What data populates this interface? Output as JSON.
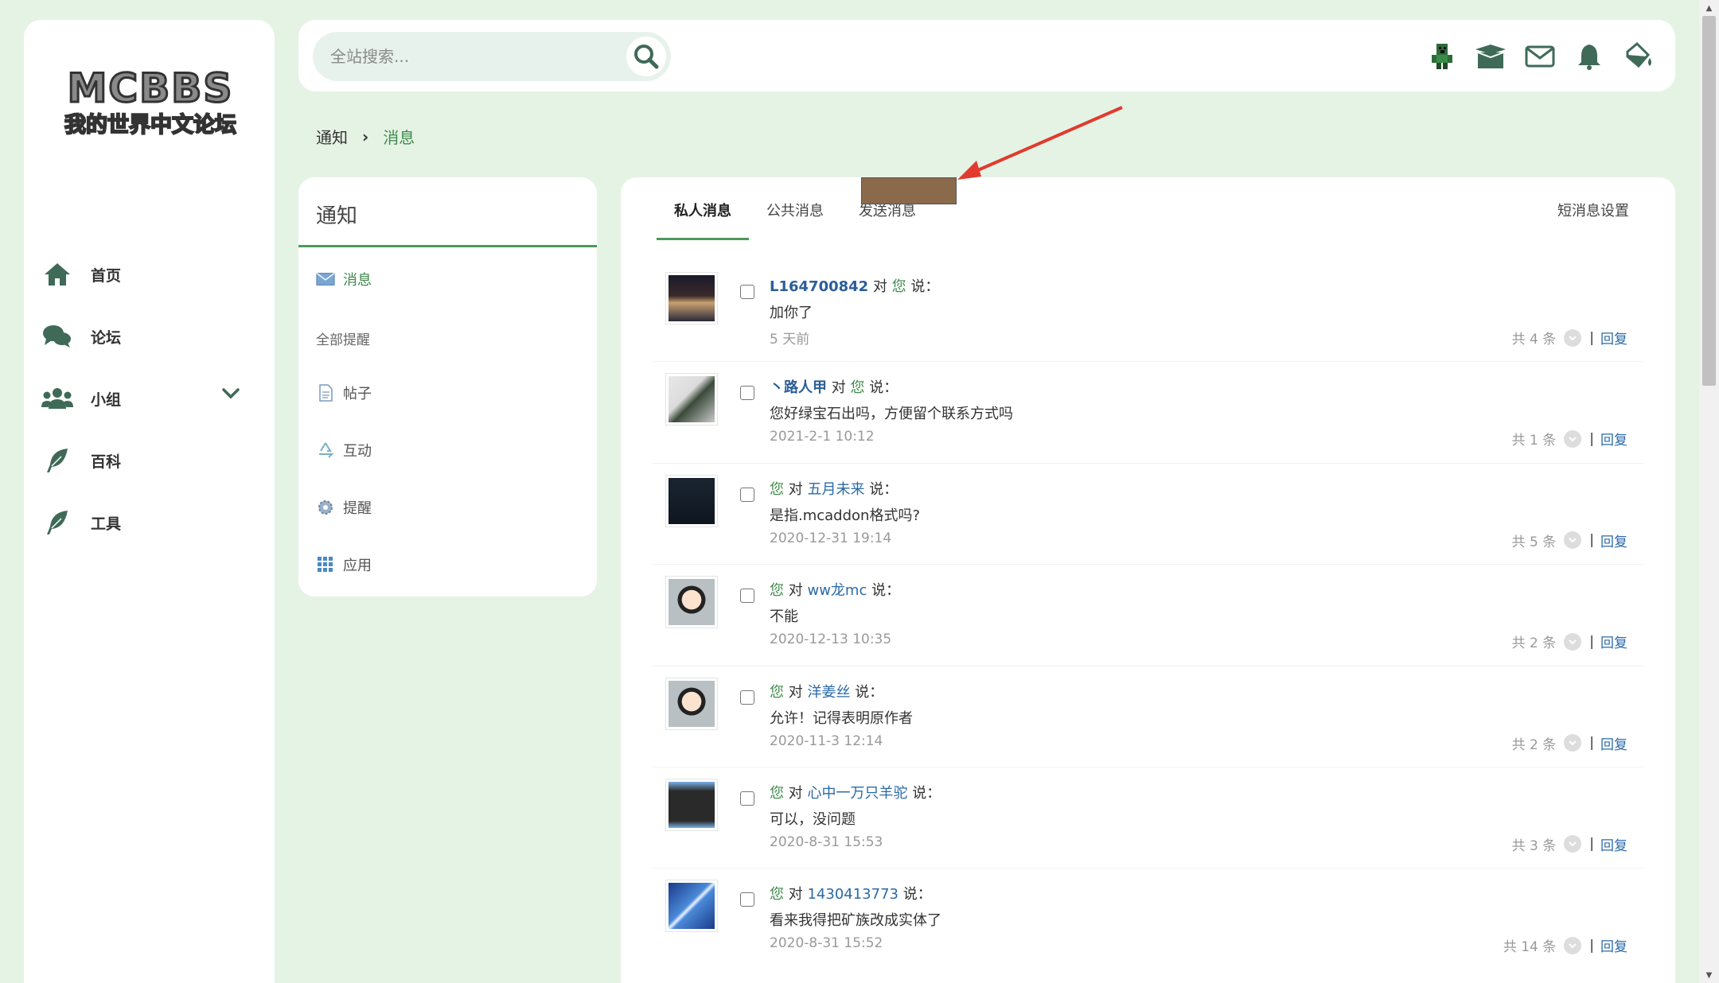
{
  "logo": {
    "line1": "MCBBS",
    "line2": "我的世界中文论坛"
  },
  "sidebar": {
    "items": [
      {
        "label": "首页",
        "icon": "home-icon"
      },
      {
        "label": "论坛",
        "icon": "comments-icon"
      },
      {
        "label": "小组",
        "icon": "users-icon"
      },
      {
        "label": "百科",
        "icon": "feather-icon"
      },
      {
        "label": "工具",
        "icon": "feather-icon"
      }
    ]
  },
  "search": {
    "placeholder": "全站搜索..."
  },
  "topbar": {
    "icons": [
      "creeper-avatar-icon",
      "box-icon",
      "mail-icon",
      "bell-icon",
      "paint-bucket-icon"
    ]
  },
  "breadcrumb": {
    "root": "通知",
    "current": "消息"
  },
  "notice_panel": {
    "title": "通知",
    "items": [
      {
        "label": "消息",
        "icon": "envelope-icon",
        "active": true
      },
      {
        "label": "全部提醒",
        "group": true
      },
      {
        "label": "帖子",
        "icon": "document-icon"
      },
      {
        "label": "互动",
        "icon": "recycle-icon"
      },
      {
        "label": "提醒",
        "icon": "gear-icon"
      },
      {
        "label": "应用",
        "icon": "grid-icon"
      }
    ]
  },
  "tabs": {
    "private": "私人消息",
    "public": "公共消息",
    "send": "发送消息",
    "settings": "短消息设置"
  },
  "messages": [
    {
      "from": "L164700842",
      "connector": "对",
      "to": "您",
      "suffix": "说：",
      "body": "加你了",
      "time": "5 天前",
      "count": "共 4 条",
      "reply": "回复",
      "from_is_you": false
    },
    {
      "from": "丶路人甲",
      "connector": "对",
      "to": "您",
      "suffix": "说：",
      "body": "您好绿宝石出吗，方便留个联系方式吗",
      "time": "2021-2-1 10:12",
      "count": "共 1 条",
      "reply": "回复",
      "from_is_you": false
    },
    {
      "from": "您",
      "connector": "对",
      "to": "五月未来",
      "suffix": "说：",
      "body": "是指.mcaddon格式吗?",
      "time": "2020-12-31 19:14",
      "count": "共 5 条",
      "reply": "回复",
      "from_is_you": true
    },
    {
      "from": "您",
      "connector": "对",
      "to": "ww龙mc",
      "suffix": "说：",
      "body": "不能",
      "time": "2020-12-13 10:35",
      "count": "共 2 条",
      "reply": "回复",
      "from_is_you": true
    },
    {
      "from": "您",
      "connector": "对",
      "to": "洋姜丝",
      "suffix": "说：",
      "body": "允许！记得表明原作者",
      "time": "2020-11-3 12:14",
      "count": "共 2 条",
      "reply": "回复",
      "from_is_you": true
    },
    {
      "from": "您",
      "connector": "对",
      "to": "心中一万只羊驼",
      "suffix": "说：",
      "body": "可以，没问题",
      "time": "2020-8-31 15:53",
      "count": "共 3 条",
      "reply": "回复",
      "from_is_you": true
    },
    {
      "from": "您",
      "connector": "对",
      "to": "1430413773",
      "suffix": "说：",
      "body": "看来我得把矿族改成实体了",
      "time": "2020-8-31 15:52",
      "count": "共 14 条",
      "reply": "回复",
      "from_is_you": true
    }
  ],
  "colors": {
    "accent": "#4b9a58",
    "link": "#2b6aa8",
    "background": "#e5f3e5"
  }
}
